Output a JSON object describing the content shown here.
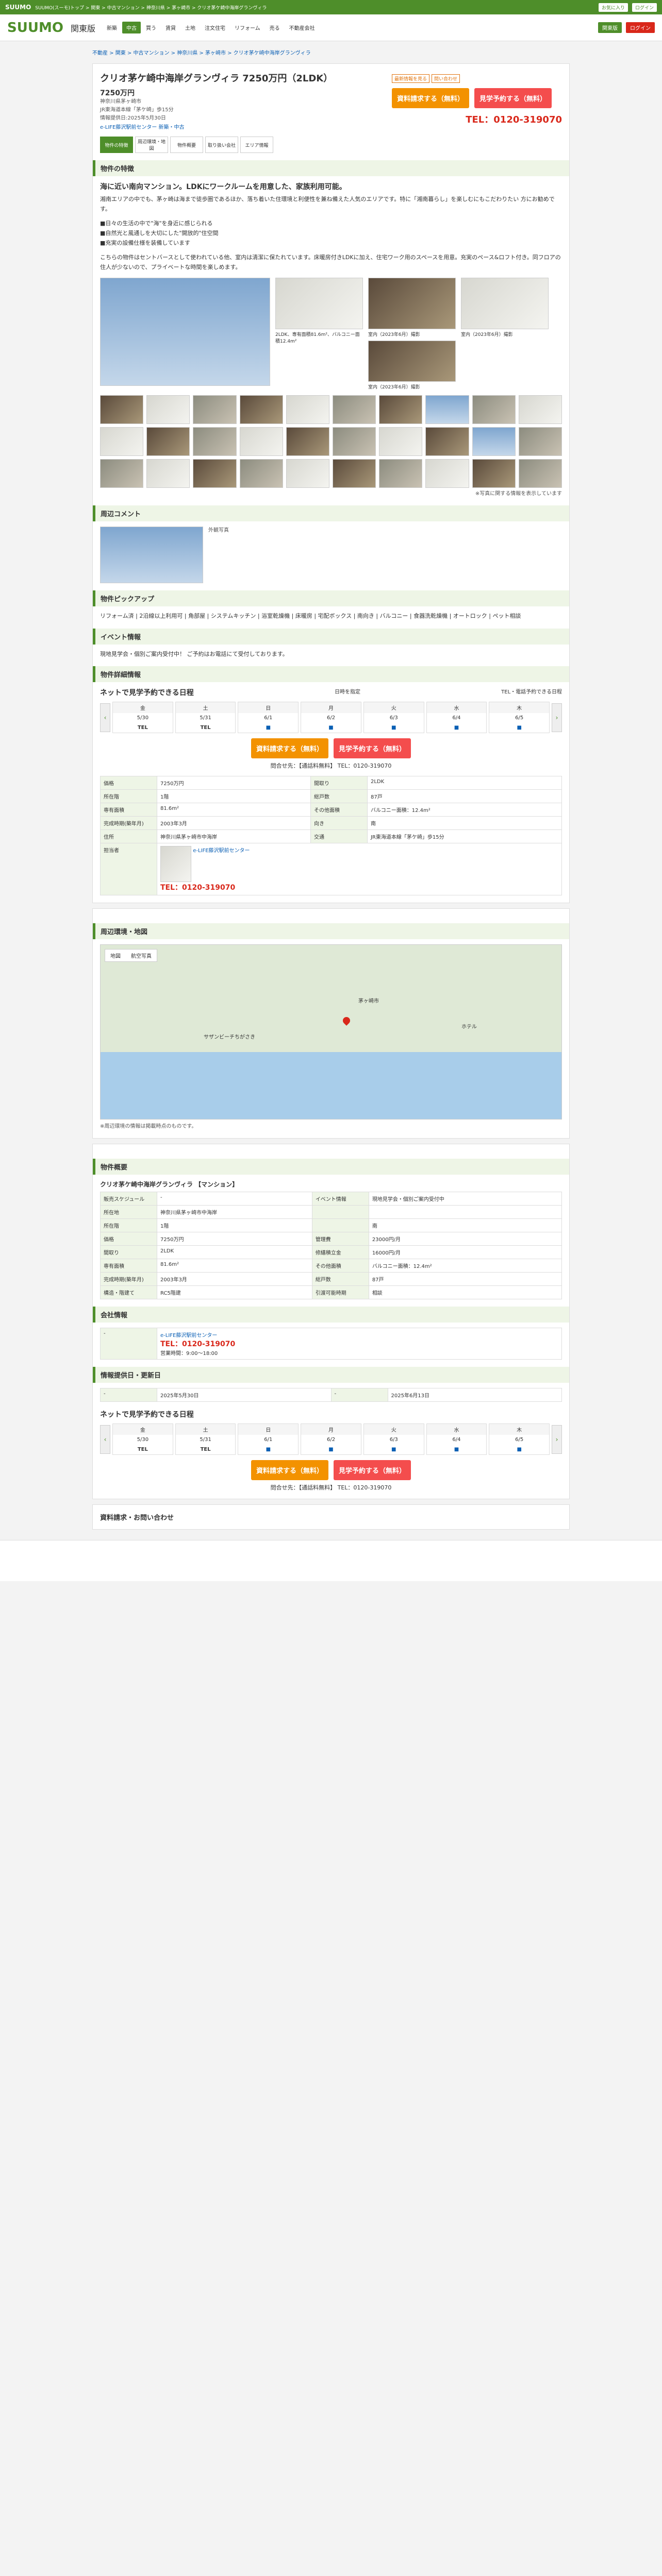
{
  "top": {
    "logo": "SUUMO",
    "desc": "SUUMO(スーモ)トップ > 関東 > 中古マンション > 神奈川県 > 茅ヶ崎市 > クリオ茅ケ崎中海岸グランヴィラ",
    "btn1": "お気に入り",
    "btn2": "ログイン"
  },
  "header": {
    "logo": "SUUMO",
    "area": "関東版",
    "nav": [
      "新築",
      "中古",
      "買う",
      "賃貸",
      "土地",
      "注文住宅",
      "リフォーム",
      "売る",
      "不動産会社"
    ],
    "active": "中古",
    "pill1": "関東版",
    "pill2": "ログイン"
  },
  "breadcrumb": "不動産 > 関東 > 中古マンション > 神奈川県 > 茅ヶ崎市 > クリオ茅ケ崎中海岸グランヴィラ",
  "property": {
    "title": "クリオ茅ケ崎中海岸グランヴィラ 7250万円（2LDK）",
    "tag1": "最新情報を見る",
    "tag2": "問い合わせ",
    "price": "7250万円",
    "addr": "神奈川県茅ヶ崎市",
    "station": "JR東海道本線「茅ケ崎」歩15分",
    "info_date": "情報提供日:2025年5月30日",
    "company_link": "e-LIFE藤沢駅前センター 新築・中古",
    "btn_request": "資料請求する（無料）",
    "btn_visit": "見学予約する（無料）",
    "tel": "TEL：0120-319070"
  },
  "tabs": [
    "物件の特徴",
    "周辺環境・地図",
    "物件概要",
    "取り扱い会社",
    "エリア情報"
  ],
  "features": {
    "section": "物件の特徴",
    "catch": "海に近い南向マンション。LDKにワークルームを用意した、家族利用可能。",
    "p1": "湘南エリアの中でも、茅ヶ崎は海まで徒歩圏であるほか、落ち着いた住環境と利便性を兼ね備えた人気のエリアです。特に「湘南暮らし」を楽しむにもこだわりたい 方にお勧めです。",
    "p2": "■日々の生活の中で\"海\"を身近に感じられる\n■自然光と風通しを大切にした\"開放的\"住空間\n■充実の設備仕様を装備しています",
    "p3": "こちらの物件はセントバースとして使われている他、室内は清潔に保たれています。床暖房付きLDKに加え、住宅ワーク用のスペースを用意。充実のペース&ロフト付き。同フロアの住人が少ないので、プライベートな時間を楽しめます。"
  },
  "captions": {
    "c1": "2LDK、専有面積81.6m²、バルコニー面積12.4m²",
    "c2": "室内（2023年6月）撮影",
    "c3": "室内（2023年6月）撮影",
    "c4": "室内（2023年6月）撮影"
  },
  "thumb_count_note": "※写真に関する情報を表示しています",
  "staff": {
    "section": "周辺コメント",
    "label": "外観写真"
  },
  "pickup": {
    "section": "物件ピックアップ",
    "text": "リフォーム済 | 2沿線以上利用可 | 角部屋 | システムキッチン | 浴室乾燥機 | 床暖房 | 宅配ボックス | 南向き | バルコニー | 食器洗乾燥機 | オートロック | ペット相談"
  },
  "event": {
    "section": "イベント情報",
    "text": "現地見学会・個別ご案内受付中！ ご予約はお電話にて受付しております。"
  },
  "detail_section": "物件詳細情報",
  "calendar": {
    "title": "ネットで見学予約できる日程",
    "radio1": "日時を指定",
    "radio2": "TEL・電話予約できる日程",
    "days": [
      {
        "w": "金",
        "d": "5/30",
        "s": "TEL"
      },
      {
        "w": "土",
        "d": "5/31",
        "s": "TEL"
      },
      {
        "w": "日",
        "d": "6/1",
        "s": "■"
      },
      {
        "w": "月",
        "d": "6/2",
        "s": "■"
      },
      {
        "w": "火",
        "d": "6/3",
        "s": "■"
      },
      {
        "w": "水",
        "d": "6/4",
        "s": "■"
      },
      {
        "w": "木",
        "d": "6/5",
        "s": "■"
      }
    ]
  },
  "inquiry": "問合せ先：【通話料無料】 TEL：0120-319070",
  "spec": {
    "rows": [
      [
        "価格",
        "7250万円",
        "間取り",
        "2LDK"
      ],
      [
        "所在階",
        "1階",
        "総戸数",
        "87戸"
      ],
      [
        "専有面積",
        "81.6m²",
        "その他面積",
        "バルコニー面積：12.4m²"
      ],
      [
        "完成時期(築年月)",
        "2003年3月",
        "向き",
        "南"
      ],
      [
        "住所",
        "神奈川県茅ヶ崎市中海岸",
        "交通",
        "JR東海道本線「茅ケ崎」歩15分"
      ]
    ],
    "staff_name": "担当者",
    "staff_company": "e-LIFE藤沢駅前センター",
    "staff_tel": "TEL：0120-319070"
  },
  "map": {
    "section": "周辺環境・地図",
    "tab1": "地図",
    "tab2": "航空写真",
    "label1": "サザンビーチちがさき",
    "label2": "茅ヶ崎市",
    "label3": "ホテル"
  },
  "notes": "※周辺環境の情報は掲載時点のものです。",
  "overview": {
    "section": "物件概要",
    "sub": "クリオ茅ケ崎中海岸グランヴィラ 【マンション】",
    "rows": [
      [
        "販売スケジュール",
        "-",
        "イベント情報",
        "現地見学会・個別ご案内受付中"
      ],
      [
        "所在地",
        "神奈川県茅ヶ崎市中海岸",
        "",
        ""
      ],
      [
        "所在階",
        "1階",
        "",
        "南"
      ],
      [
        "価格",
        "7250万円",
        "管理費",
        "23000円/月"
      ],
      [
        "間取り",
        "2LDK",
        "修繕積立金",
        "16000円/月"
      ],
      [
        "専有面積",
        "81.6m²",
        "その他面積",
        "バルコニー面積：12.4m²"
      ],
      [
        "完成時期(築年月)",
        "2003年3月",
        "総戸数",
        "87戸"
      ],
      [
        "構造・階建て",
        "RC5階建",
        "引渡可能時期",
        "相談"
      ]
    ]
  },
  "company": {
    "section": "会社情報",
    "name": "e-LIFE藤沢駅前センター",
    "tel": "TEL：0120-319070",
    "hours": "営業時間：9:00～18:00"
  },
  "update": {
    "section": "情報提供日・更新日",
    "date1": "2025年5月30日",
    "date2": "2025年6月13日"
  },
  "bottom_title": "資料請求・お問い合わせ"
}
